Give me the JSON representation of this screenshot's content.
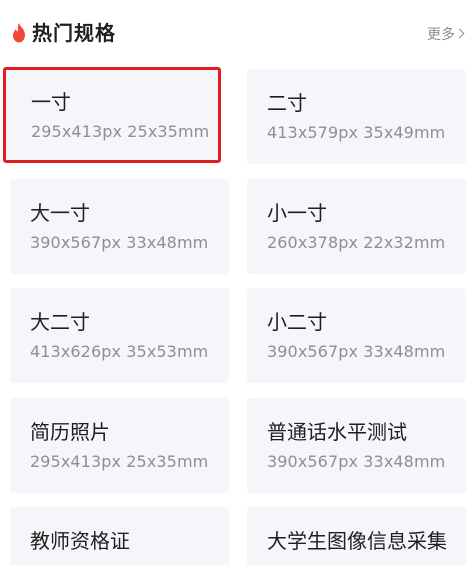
{
  "header": {
    "title": "热门规格",
    "more_label": "更多",
    "flame_color": "#f2473a"
  },
  "accent_color": "#e02020",
  "specs": [
    {
      "name": "一寸",
      "spec": "295x413px 25x35mm",
      "selected": true
    },
    {
      "name": "二寸",
      "spec": "413x579px 35x49mm"
    },
    {
      "name": "大一寸",
      "spec": "390x567px 33x48mm"
    },
    {
      "name": "小一寸",
      "spec": "260x378px 22x32mm"
    },
    {
      "name": "大二寸",
      "spec": "413x626px 35x53mm"
    },
    {
      "name": "小二寸",
      "spec": "390x567px 33x48mm"
    },
    {
      "name": "简历照片",
      "spec": "295x413px 25x35mm"
    },
    {
      "name": "普通话水平测试",
      "spec": "390x567px 33x48mm"
    },
    {
      "name": "教师资格证",
      "spec": ""
    },
    {
      "name": "大学生图像信息采集",
      "spec": ""
    }
  ]
}
